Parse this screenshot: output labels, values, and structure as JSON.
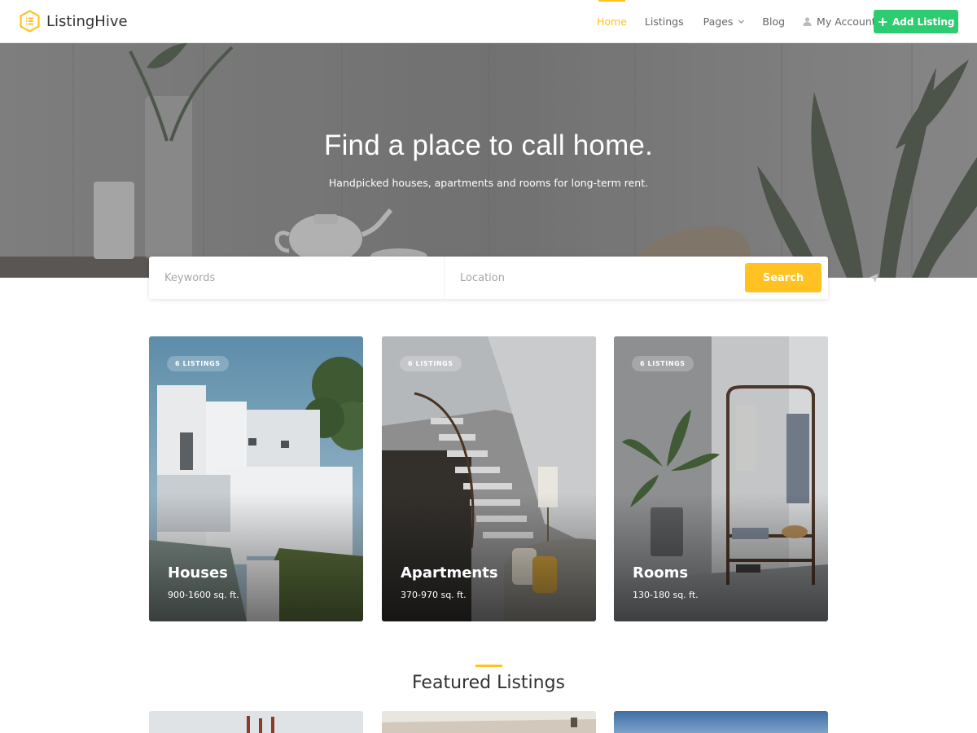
{
  "brand": {
    "name": "ListingHive",
    "accent": "#ffc222",
    "cta_color": "#2ecc71"
  },
  "nav": {
    "items": [
      {
        "label": "Home",
        "active": true
      },
      {
        "label": "Listings"
      },
      {
        "label": "Pages",
        "has_dropdown": true
      },
      {
        "label": "Blog"
      },
      {
        "label": "My Account",
        "icon": "user-icon"
      }
    ],
    "add_listing_label": "Add Listing"
  },
  "hero": {
    "title": "Find a place to call home.",
    "subtitle": "Handpicked houses, apartments and rooms for long-term rent."
  },
  "search": {
    "keywords_placeholder": "Keywords",
    "location_placeholder": "Location",
    "button_label": "Search"
  },
  "categories": [
    {
      "badge": "6 LISTINGS",
      "title": "Houses",
      "size": "900-1600 sq. ft."
    },
    {
      "badge": "6 LISTINGS",
      "title": "Apartments",
      "size": "370-970 sq. ft."
    },
    {
      "badge": "6 LISTINGS",
      "title": "Rooms",
      "size": "130-180 sq. ft."
    }
  ],
  "featured": {
    "title": "Featured Listings"
  }
}
